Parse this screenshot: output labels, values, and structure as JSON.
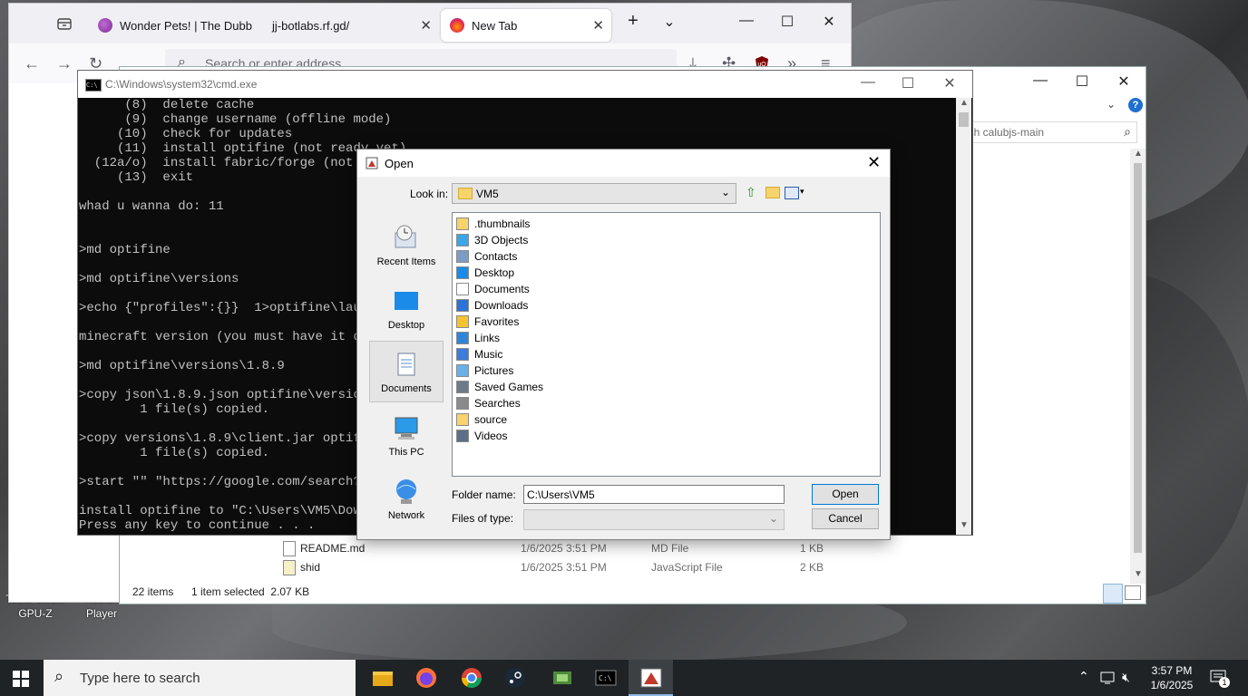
{
  "browser": {
    "tabs": [
      {
        "label": "Wonder Pets! | The Dubb"
      },
      {
        "label": "jj-botlabs.rf.gd/"
      },
      {
        "label": "New Tab"
      }
    ],
    "address_placeholder": "Search or enter address"
  },
  "explorer": {
    "search_placeholder": "arch calubjs-main",
    "rows": [
      {
        "name": "README.md",
        "date": "1/6/2025 3:51 PM",
        "type": "MD File",
        "size": "1 KB"
      },
      {
        "name": "shid",
        "date": "1/6/2025 3:51 PM",
        "type": "JavaScript File",
        "size": "2 KB"
      }
    ],
    "status_items": "22 items",
    "status_selected": "1 item selected  2.07 KB"
  },
  "cmd": {
    "title": "C:\\Windows\\system32\\cmd.exe",
    "lines": [
      "      (8)  delete cache",
      "      (9)  change username (offline mode)",
      "     (10)  check for updates",
      "     (11)  install optifine (not ready yet)",
      "  (12a/o)  install fabric/forge (not",
      "     (13)  exit",
      "",
      "whad u wanna do: 11",
      "",
      "",
      ">md optifine",
      "",
      ">md optifine\\versions",
      "",
      ">echo {\"profiles\":{}}  1>optifine\\laun",
      "",
      "minecraft version (you must have it do",
      "",
      ">md optifine\\versions\\1.8.9",
      "",
      ">copy json\\1.8.9.json optifine\\version",
      "        1 file(s) copied.",
      "",
      ">copy versions\\1.8.9\\client.jar optifi",
      "        1 file(s) copied.",
      "",
      ">start \"\" \"https://google.com/search?q",
      "",
      "install optifine to \"C:\\Users\\VM5\\Down",
      "Press any key to continue . . ."
    ]
  },
  "dialog": {
    "title": "Open",
    "look_in_label": "Look in:",
    "look_in_value": "VM5",
    "places": [
      {
        "label": "Recent Items",
        "icon": "recent-items-icon"
      },
      {
        "label": "Desktop",
        "icon": "desktop-icon"
      },
      {
        "label": "Documents",
        "icon": "documents-icon"
      },
      {
        "label": "This PC",
        "icon": "this-pc-icon"
      },
      {
        "label": "Network",
        "icon": "network-icon"
      }
    ],
    "items": [
      {
        "label": ".thumbnails",
        "icon": "folder-icon"
      },
      {
        "label": "3D Objects",
        "icon": "3d-objects-icon"
      },
      {
        "label": "Contacts",
        "icon": "contacts-icon"
      },
      {
        "label": "Desktop",
        "icon": "desktop-icon"
      },
      {
        "label": "Documents",
        "icon": "documents-icon"
      },
      {
        "label": "Downloads",
        "icon": "downloads-icon"
      },
      {
        "label": "Favorites",
        "icon": "star-icon"
      },
      {
        "label": "Links",
        "icon": "links-icon"
      },
      {
        "label": "Music",
        "icon": "music-icon"
      },
      {
        "label": "Pictures",
        "icon": "pictures-icon"
      },
      {
        "label": "Saved Games",
        "icon": "saved-games-icon"
      },
      {
        "label": "Searches",
        "icon": "search-icon"
      },
      {
        "label": "source",
        "icon": "folder-icon"
      },
      {
        "label": "Videos",
        "icon": "videos-icon"
      }
    ],
    "folder_name_label": "Folder name:",
    "folder_name_value": "C:\\Users\\VM5",
    "files_of_type_label": "Files of type:",
    "open_label": "Open",
    "cancel_label": "Cancel"
  },
  "desktop": {
    "labels": [
      "TechPowe...\nGPU-Z",
      "Roblox\nPlayer"
    ]
  },
  "taskbar": {
    "search_placeholder": "Type here to search",
    "time": "3:57 PM",
    "date": "1/6/2025",
    "notifications": "1"
  }
}
